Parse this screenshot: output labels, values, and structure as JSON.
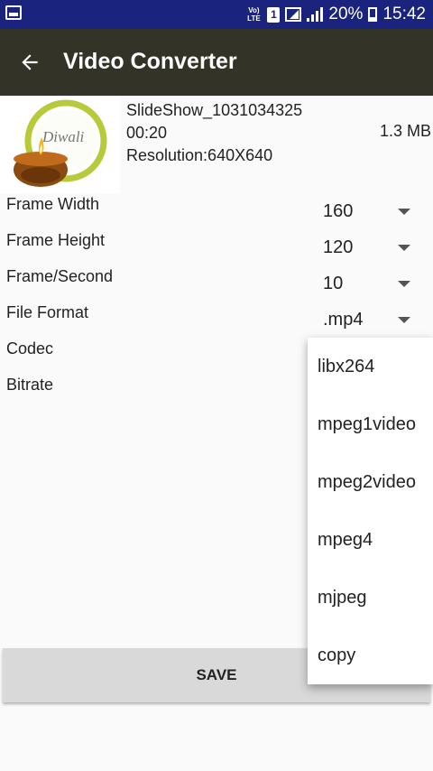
{
  "status_bar": {
    "volte": "Vo) LTE",
    "sim": "1",
    "battery": "20%",
    "time": "15:42"
  },
  "app_bar": {
    "title": "Video Converter"
  },
  "video": {
    "name": "SlideShow_1031034325",
    "duration": "00:20",
    "size": "1.3 MB",
    "resolution": "Resolution:640X640",
    "thumbnail_text": "Diwali"
  },
  "settings": {
    "frame_width": {
      "label": "Frame Width",
      "value": "160"
    },
    "frame_height": {
      "label": "Frame Height",
      "value": "120"
    },
    "frame_rate": {
      "label": "Frame/Second",
      "value": "10"
    },
    "file_format": {
      "label": "File Format",
      "value": ".mp4"
    },
    "codec": {
      "label": "Codec"
    },
    "bitrate": {
      "label": "Bitrate"
    }
  },
  "codec_options": [
    "libx264",
    "mpeg1video",
    "mpeg2video",
    "mpeg4",
    "mjpeg",
    "copy"
  ],
  "save_label": "SAVE",
  "colors": {
    "status_bar": "#1a237e",
    "app_bar": "#333327",
    "background": "#fafafa"
  }
}
